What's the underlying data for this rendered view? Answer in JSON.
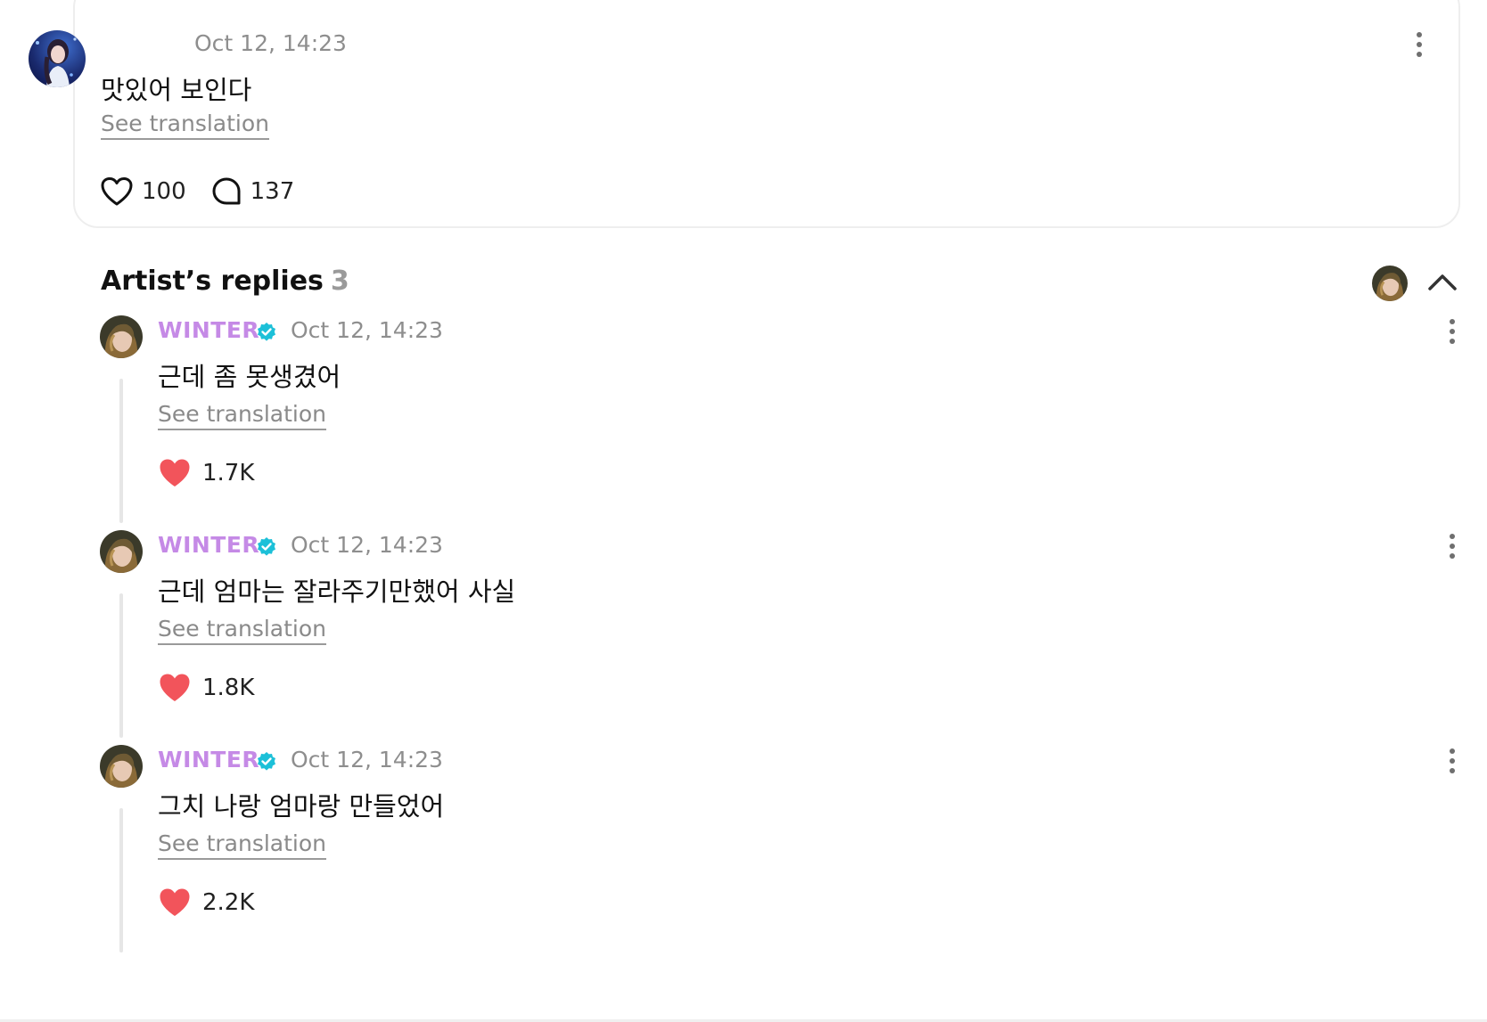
{
  "post": {
    "timestamp": "Oct 12, 14:23",
    "text": "맛있어 보인다",
    "translate_label": "See translation",
    "likes": "100",
    "comments": "137",
    "icons": {
      "like": "heart-outline-icon",
      "comment": "comment-bubble-icon",
      "more": "more-vertical-icon"
    }
  },
  "artist_replies": {
    "title": "Artist’s replies",
    "count": "3",
    "collapse_icon": "chevron-up-icon"
  },
  "replies": [
    {
      "author": "WINTER",
      "timestamp": "Oct 12, 14:23",
      "text": "근데 좀 못생겼어",
      "translate_label": "See translation",
      "likes": "1.7K"
    },
    {
      "author": "WINTER",
      "timestamp": "Oct 12, 14:23",
      "text": "근데 엄마는 잘라주기만했어 사실",
      "translate_label": "See translation",
      "likes": "1.8K"
    },
    {
      "author": "WINTER",
      "timestamp": "Oct 12, 14:23",
      "text": "그치 나랑 엄마랑 만들었어",
      "translate_label": "See translation",
      "likes": "2.2K"
    }
  ],
  "colors": {
    "artist_name": "#c58ae6",
    "verified_badge": "#1cc0d8",
    "liked_heart": "#f2545b",
    "muted_text": "#8e8e8e"
  }
}
